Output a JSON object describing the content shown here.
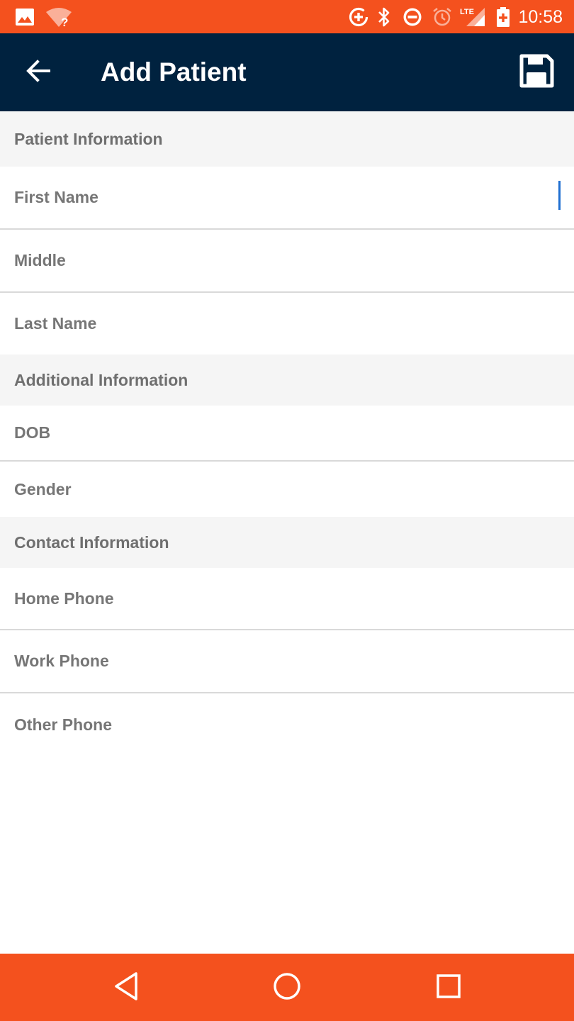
{
  "status_bar": {
    "time": "10:58",
    "icons": [
      "image-icon",
      "wifi-unknown-icon",
      "data-saver-icon",
      "bluetooth-icon",
      "do-not-disturb-icon",
      "alarm-icon",
      "lte-signal-icon",
      "battery-charging-icon"
    ],
    "lte_label": "LTE",
    "wifi_label": "?"
  },
  "app_bar": {
    "title": "Add Patient",
    "back_icon": "arrow-back-icon",
    "save_icon": "save-floppy-icon"
  },
  "form": {
    "patient_section": {
      "title": "Patient Information",
      "fields": [
        "First Name",
        "Middle",
        "Last Name"
      ]
    },
    "additional_section": {
      "title": "Additional Information",
      "fields": [
        "DOB",
        "Gender"
      ]
    },
    "contact_section": {
      "title": "Contact Information",
      "fields": [
        "Home Phone",
        "Work Phone",
        "Other Phone"
      ]
    }
  },
  "nav_bar": {
    "icons": [
      "back-triangle-icon",
      "home-circle-icon",
      "recents-square-icon"
    ]
  },
  "colors": {
    "accent": "#f4511e",
    "app_bar": "#00223f",
    "section_bg": "#f5f5f5",
    "cursor": "#1f6fd1"
  }
}
